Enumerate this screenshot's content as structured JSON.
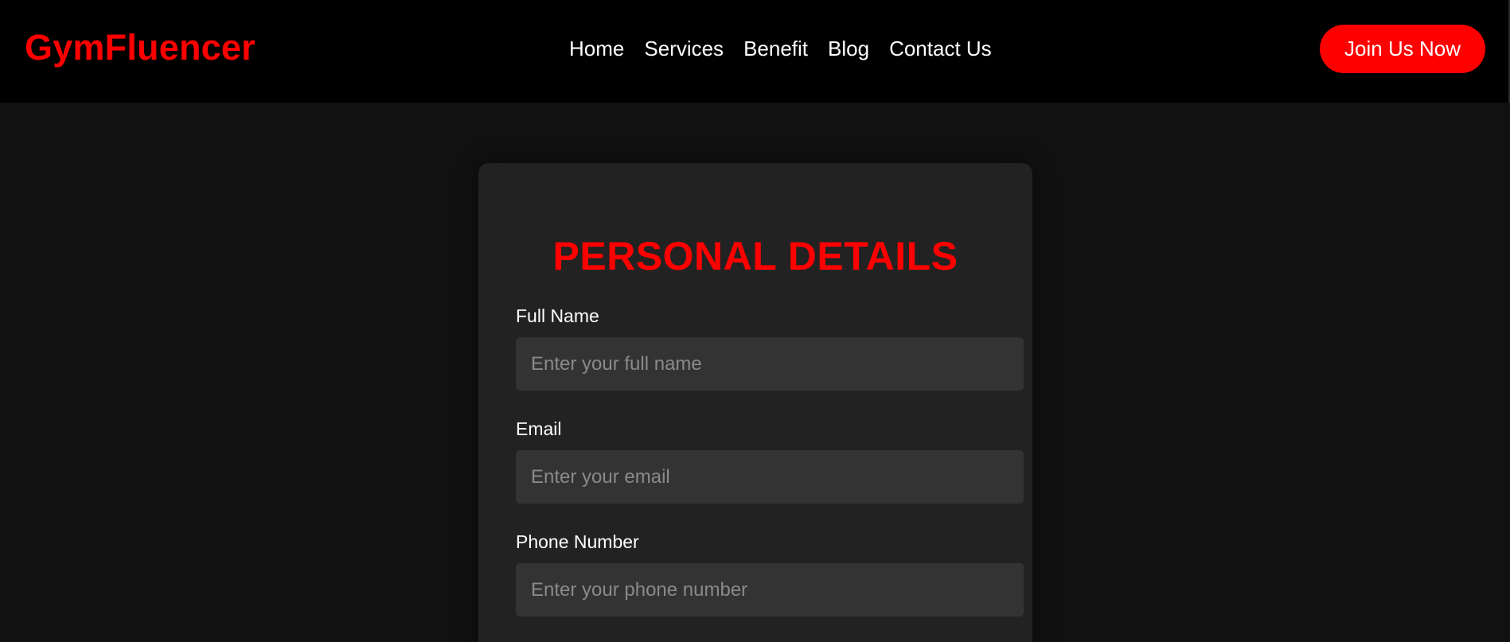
{
  "brand": {
    "name": "GymFluencer",
    "accent_color": "#ff0000"
  },
  "nav": {
    "links": [
      {
        "label": "Home"
      },
      {
        "label": "Services"
      },
      {
        "label": "Benefit"
      },
      {
        "label": "Blog"
      },
      {
        "label": "Contact Us"
      }
    ],
    "cta_label": "Join Us Now"
  },
  "form": {
    "title": "PERSONAL DETAILS",
    "fields": [
      {
        "label": "Full Name",
        "value": "",
        "placeholder": "Enter your full name"
      },
      {
        "label": "Email",
        "value": "",
        "placeholder": "Enter your email"
      },
      {
        "label": "Phone Number",
        "value": "",
        "placeholder": "Enter your phone number"
      }
    ]
  },
  "colors": {
    "navbar_bg": "#000000",
    "page_bg": "#111111",
    "card_bg": "#222222",
    "input_bg": "#333333"
  }
}
